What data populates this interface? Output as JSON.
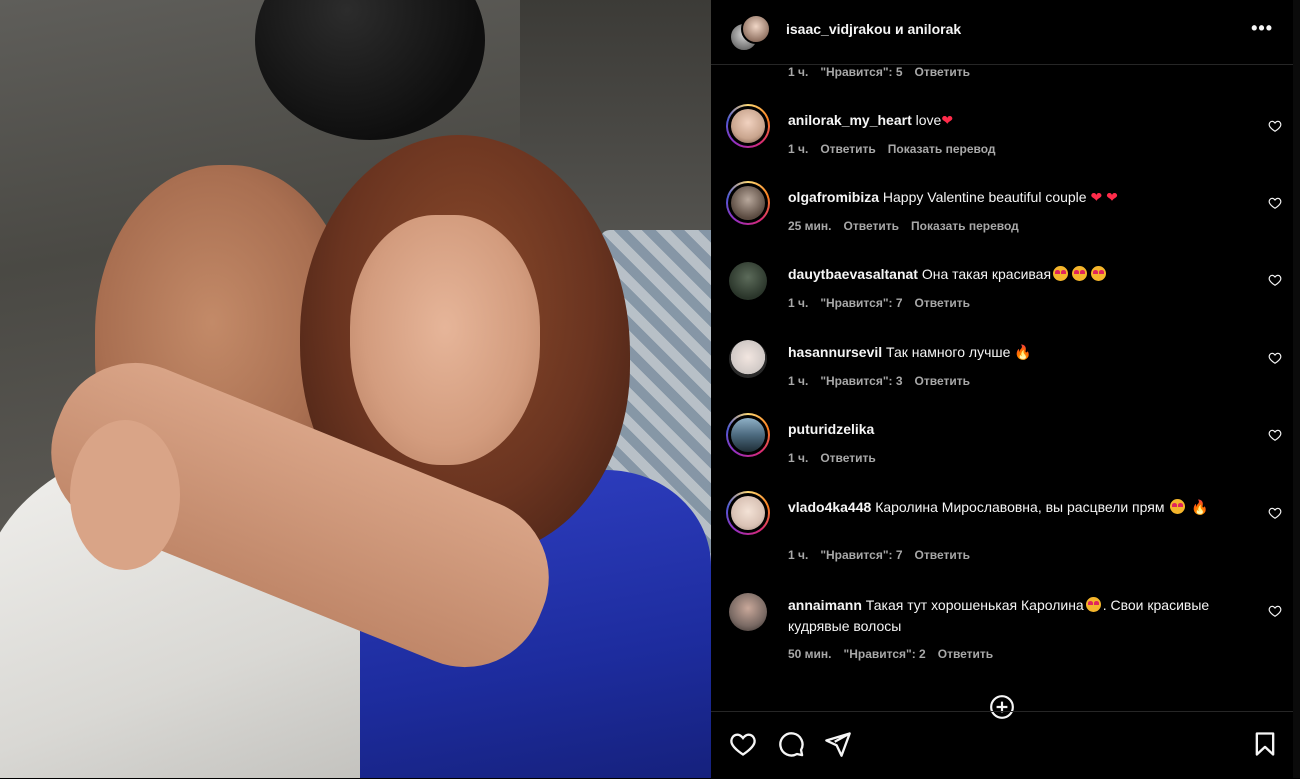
{
  "post": {
    "authors": "isaac_vidjrakou и anilorak",
    "more_label": "•••",
    "top_meta": {
      "time": "1 ч.",
      "likes": "\"Нравится\": 5",
      "reply": "Ответить"
    }
  },
  "comments": [
    {
      "user": "anilorak_my_heart",
      "text": "love",
      "emoji": "heart",
      "meta": {
        "time": "1 ч.",
        "reply": "Ответить",
        "translate": "Показать перевод"
      },
      "story_ring": true,
      "avatar_color": "#c9a58e"
    },
    {
      "user": "olgafromibiza",
      "text": "Happy Valentine beautiful couple",
      "emoji": "heart heart",
      "meta": {
        "time": "25 мин.",
        "reply": "Ответить",
        "translate": "Показать перевод"
      },
      "story_ring": true,
      "avatar_color": "#8a7a6e"
    },
    {
      "user": "dauytbaevasaltanat",
      "text": "Она такая красивая",
      "emoji": "love love love",
      "meta": {
        "time": "1 ч.",
        "likes": "\"Нравится\": 7",
        "reply": "Ответить"
      },
      "story_ring": false,
      "avatar_color": "#3b4a3a"
    },
    {
      "user": "hasannursevil",
      "text": "Так намного лучше",
      "emoji": "fire",
      "meta": {
        "time": "1 ч.",
        "likes": "\"Нравится\": 3",
        "reply": "Ответить"
      },
      "story_ring": false,
      "avatar_color": "#e8e8e8"
    },
    {
      "user": "puturidzelika",
      "text": "",
      "emoji": "",
      "meta": {
        "time": "1 ч.",
        "reply": "Ответить"
      },
      "story_ring": true,
      "avatar_color": "#4c6a7f"
    },
    {
      "user": "vlado4ka448",
      "text": "Каролина Мирославовна, вы расцвели прям",
      "emoji": "love fire",
      "meta": {
        "time": "1 ч.",
        "likes": "\"Нравится\": 7",
        "reply": "Ответить"
      },
      "story_ring": true,
      "avatar_color": "#d9c2b5"
    },
    {
      "user": "annaimann",
      "text": "Такая тут хорошенькая Каролина",
      "text2": ". Свои красивые кудрявые волосы",
      "emoji": "love",
      "meta": {
        "time": "50 мин.",
        "likes": "\"Нравится\": 2",
        "reply": "Ответить"
      },
      "story_ring": false,
      "avatar_color": "#7a6a64"
    }
  ],
  "icons": {
    "like": "heart-icon",
    "comment": "comment-icon",
    "share": "share-icon",
    "save": "bookmark-icon",
    "add_comments": "plus-circle-icon",
    "more": "more-icon"
  },
  "colors": {
    "background": "#000000",
    "text": "#f5f5f5",
    "meta": "#a8a8a8",
    "divider": "#262626",
    "heart_emoji": "#ff2b4a"
  }
}
